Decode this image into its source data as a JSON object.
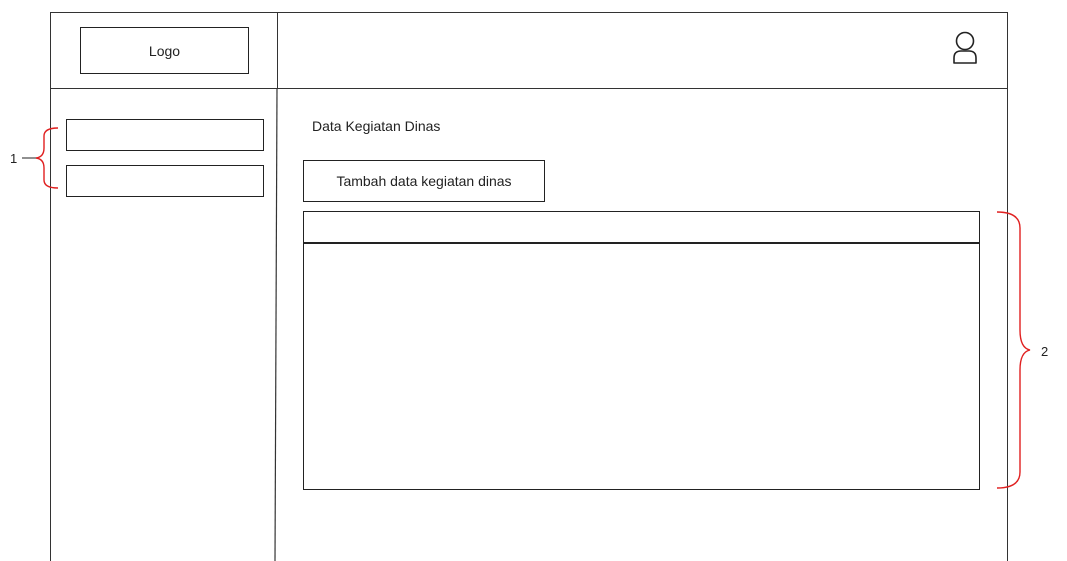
{
  "header": {
    "logo_label": "Logo"
  },
  "main": {
    "page_title": "Data Kegiatan Dinas",
    "add_button_label": "Tambah data kegiatan dinas"
  },
  "annotations": {
    "sidebar_marker": "1",
    "table_marker": "2"
  },
  "icons": {
    "user": "user-icon"
  },
  "colors": {
    "annotation_bracket": "#e02020",
    "wireframe_line": "#222222"
  }
}
